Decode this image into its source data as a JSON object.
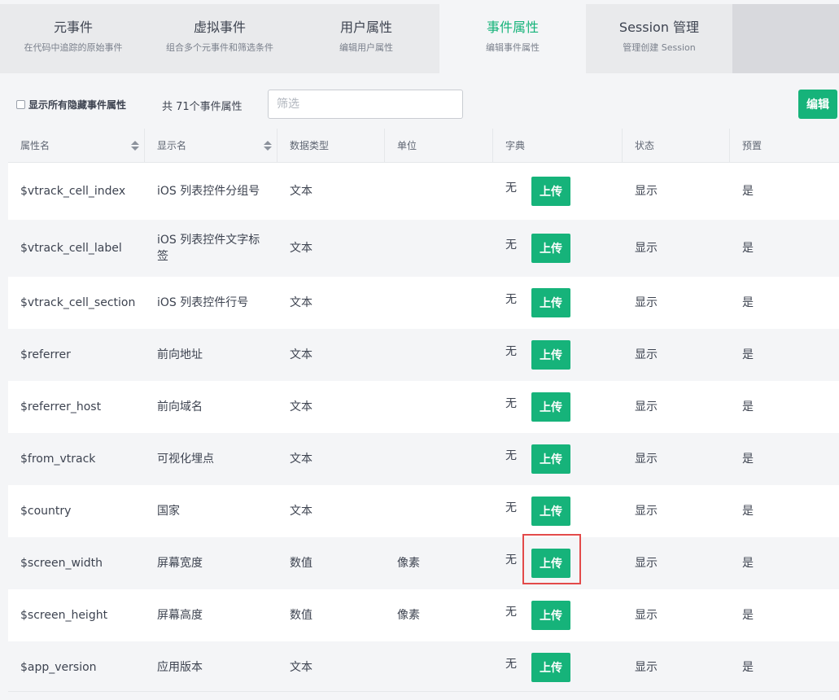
{
  "tabs": [
    {
      "title": "元事件",
      "sub": "在代码中追踪的原始事件"
    },
    {
      "title": "虚拟事件",
      "sub": "组合多个元事件和筛选条件"
    },
    {
      "title": "用户属性",
      "sub": "编辑用户属性"
    },
    {
      "title": "事件属性",
      "sub": "编辑事件属性"
    },
    {
      "title": "Session 管理",
      "sub": "管理创建 Session"
    }
  ],
  "toolbar": {
    "show_hidden_label": "显示所有隐藏事件属性",
    "count_text": "共 71个事件属性",
    "filter_placeholder": "筛选",
    "edit_label": "编辑"
  },
  "table": {
    "headers": [
      "属性名",
      "显示名",
      "数据类型",
      "单位",
      "字典",
      "状态",
      "预置"
    ],
    "upload_label": "上传",
    "rows": [
      {
        "name": "$vtrack_cell_index",
        "display": "iOS 列表控件分组号",
        "type": "文本",
        "unit": "",
        "dict": "无",
        "status": "显示",
        "preset": "是"
      },
      {
        "name": "$vtrack_cell_label",
        "display": "iOS 列表控件文字标签",
        "type": "文本",
        "unit": "",
        "dict": "无",
        "status": "显示",
        "preset": "是"
      },
      {
        "name": "$vtrack_cell_section",
        "display": "iOS 列表控件行号",
        "type": "文本",
        "unit": "",
        "dict": "无",
        "status": "显示",
        "preset": "是"
      },
      {
        "name": "$referrer",
        "display": "前向地址",
        "type": "文本",
        "unit": "",
        "dict": "无",
        "status": "显示",
        "preset": "是"
      },
      {
        "name": "$referrer_host",
        "display": "前向域名",
        "type": "文本",
        "unit": "",
        "dict": "无",
        "status": "显示",
        "preset": "是"
      },
      {
        "name": "$from_vtrack",
        "display": "可视化埋点",
        "type": "文本",
        "unit": "",
        "dict": "无",
        "status": "显示",
        "preset": "是"
      },
      {
        "name": "$country",
        "display": "国家",
        "type": "文本",
        "unit": "",
        "dict": "无",
        "status": "显示",
        "preset": "是"
      },
      {
        "name": "$screen_width",
        "display": "屏幕宽度",
        "type": "数值",
        "unit": "像素",
        "dict": "无",
        "status": "显示",
        "preset": "是"
      },
      {
        "name": "$screen_height",
        "display": "屏幕高度",
        "type": "数值",
        "unit": "像素",
        "dict": "无",
        "status": "显示",
        "preset": "是"
      },
      {
        "name": "$app_version",
        "display": "应用版本",
        "type": "文本",
        "unit": "",
        "dict": "无",
        "status": "显示",
        "preset": "是"
      }
    ]
  }
}
